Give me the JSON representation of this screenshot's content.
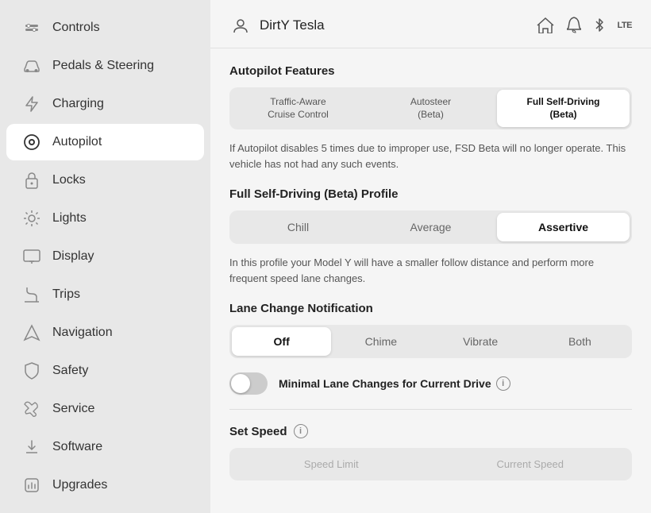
{
  "header": {
    "username": "DirtY Tesla",
    "icons": {
      "home": "⌂",
      "bell": "🔔",
      "bluetooth": "✱",
      "lte": "LTE"
    }
  },
  "sidebar": {
    "items": [
      {
        "id": "controls",
        "label": "Controls",
        "icon": "toggle"
      },
      {
        "id": "pedals",
        "label": "Pedals & Steering",
        "icon": "car"
      },
      {
        "id": "charging",
        "label": "Charging",
        "icon": "bolt"
      },
      {
        "id": "autopilot",
        "label": "Autopilot",
        "icon": "circle",
        "active": true
      },
      {
        "id": "locks",
        "label": "Locks",
        "icon": "lock"
      },
      {
        "id": "lights",
        "label": "Lights",
        "icon": "sun"
      },
      {
        "id": "display",
        "label": "Display",
        "icon": "display"
      },
      {
        "id": "trips",
        "label": "Trips",
        "icon": "trips"
      },
      {
        "id": "navigation",
        "label": "Navigation",
        "icon": "nav"
      },
      {
        "id": "safety",
        "label": "Safety",
        "icon": "safety"
      },
      {
        "id": "service",
        "label": "Service",
        "icon": "wrench"
      },
      {
        "id": "software",
        "label": "Software",
        "icon": "download"
      },
      {
        "id": "upgrades",
        "label": "Upgrades",
        "icon": "upgrades"
      }
    ]
  },
  "main": {
    "autopilot_features": {
      "title": "Autopilot Features",
      "tabs": [
        {
          "id": "tacc",
          "label": "Traffic-Aware\nCruise Control",
          "active": false
        },
        {
          "id": "autosteer",
          "label": "Autosteer\n(Beta)",
          "active": false
        },
        {
          "id": "fsd",
          "label": "Full Self-Driving\n(Beta)",
          "active": true
        }
      ],
      "description": "If Autopilot disables 5 times due to improper use, FSD Beta will no longer operate. This vehicle has not had any such events."
    },
    "fsd_profile": {
      "title": "Full Self-Driving (Beta) Profile",
      "options": [
        {
          "id": "chill",
          "label": "Chill",
          "active": false
        },
        {
          "id": "average",
          "label": "Average",
          "active": false
        },
        {
          "id": "assertive",
          "label": "Assertive",
          "active": true
        }
      ],
      "description": "In this profile your Model Y will have a smaller follow distance and perform more frequent speed lane changes."
    },
    "lane_change": {
      "title": "Lane Change Notification",
      "options": [
        {
          "id": "off",
          "label": "Off",
          "active": true
        },
        {
          "id": "chime",
          "label": "Chime",
          "active": false
        },
        {
          "id": "vibrate",
          "label": "Vibrate",
          "active": false
        },
        {
          "id": "both",
          "label": "Both",
          "active": false
        }
      ]
    },
    "minimal_lane": {
      "label": "Minimal Lane Changes for Current Drive",
      "enabled": false
    },
    "set_speed": {
      "title": "Set Speed",
      "options": [
        {
          "id": "speed_limit",
          "label": "Speed Limit",
          "active": false
        },
        {
          "id": "current_speed",
          "label": "Current Speed",
          "active": false
        }
      ]
    }
  }
}
